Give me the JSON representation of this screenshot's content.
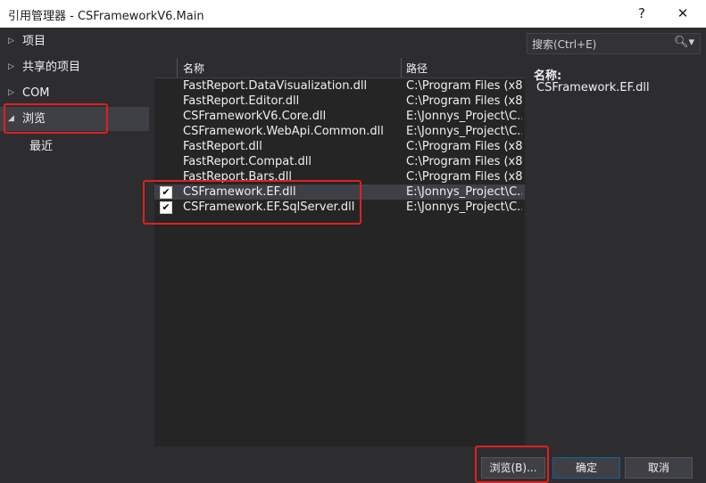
{
  "window": {
    "title": "引用管理器 - CSFrameworkV6.Main",
    "help": "?",
    "close": "✕"
  },
  "tree": [
    {
      "arrow": "▷",
      "label": "项目"
    },
    {
      "arrow": "▷",
      "label": "共享的项目"
    },
    {
      "arrow": "▷",
      "label": "COM"
    },
    {
      "arrow": "◢",
      "label": "浏览"
    },
    {
      "arrow": "",
      "label": "最近"
    }
  ],
  "list": {
    "header_name": "名称",
    "header_path": "路径",
    "rows": [
      {
        "checked": false,
        "mark": "",
        "name": "FastReport.DataVisualization.dll",
        "path": "C:\\Program Files (x8..."
      },
      {
        "checked": false,
        "mark": "",
        "name": "FastReport.Editor.dll",
        "path": "C:\\Program Files (x8..."
      },
      {
        "checked": false,
        "mark": "",
        "name": "CSFrameworkV6.Core.dll",
        "path": "E:\\Jonnys_Project\\C..."
      },
      {
        "checked": false,
        "mark": "",
        "name": "CSFramework.WebApi.Common.dll",
        "path": "E:\\Jonnys_Project\\C..."
      },
      {
        "checked": false,
        "mark": "",
        "name": "FastReport.dll",
        "path": "C:\\Program Files (x8..."
      },
      {
        "checked": false,
        "mark": "",
        "name": "FastReport.Compat.dll",
        "path": "C:\\Program Files (x8..."
      },
      {
        "checked": false,
        "mark": "",
        "name": "FastReport.Bars.dll",
        "path": "C:\\Program Files (x8..."
      },
      {
        "checked": true,
        "mark": "✔",
        "name": "CSFramework.EF.dll",
        "path": "E:\\Jonnys_Project\\C..."
      },
      {
        "checked": true,
        "mark": "✔",
        "name": "CSFramework.EF.SqlServer.dll",
        "path": "E:\\Jonnys_Project\\C..."
      }
    ]
  },
  "search": {
    "placeholder": "搜索(Ctrl+E)",
    "icon": "search-icon"
  },
  "details": {
    "name_label": "名称:",
    "name_value": "CSFramework.EF.dll"
  },
  "buttons": {
    "browse": "浏览(B)...",
    "ok": "确定",
    "cancel": "取消"
  },
  "colors": {
    "highlight": "#e02020",
    "background": "#2d2d30",
    "list_bg": "#252526",
    "accent": "#0e639c"
  }
}
